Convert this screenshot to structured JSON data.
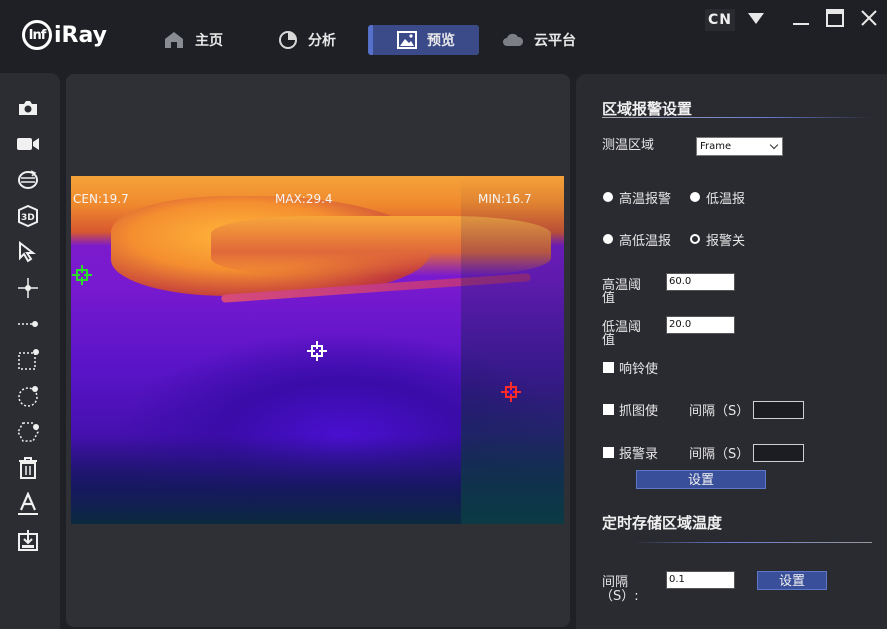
{
  "app": {
    "logo_badge": "Inf",
    "logo_text": "iRay"
  },
  "nav": {
    "home": "主页",
    "analysis": "分析",
    "preview": "预览",
    "cloud": "云平台"
  },
  "lang": {
    "code": "CN"
  },
  "thermal": {
    "cen": "CEN:19.7",
    "max": "MAX:29.4",
    "min": "MIN:16.7"
  },
  "settings": {
    "alarm_title": "区域报警设置",
    "measure_area_label": "测温区域",
    "measure_area_value": "Frame",
    "radio_high": "高温报警",
    "radio_low": "低温报",
    "radio_highlow": "高低温报",
    "radio_off": "报警关",
    "high_threshold_label_1": "高温阈",
    "high_threshold_label_2": "值",
    "high_threshold_value": "60.0",
    "low_threshold_label_1": "低温阈",
    "low_threshold_label_2": "值",
    "low_threshold_value": "20.0",
    "bell_label": "响铃使",
    "capture_label": "抓图使",
    "capture_interval_label": "间隔（S）",
    "record_label": "报警录",
    "record_interval_label": "间隔（S）",
    "set_button": "设置",
    "timed_title": "定时存储区域温度",
    "timed_interval_label_1": "间隔",
    "timed_interval_label_2": "（S）:",
    "timed_interval_value": "0.1",
    "timed_set_button": "设置"
  },
  "colors": {
    "accent": "#3b4b8a",
    "button": "#3a4f9a",
    "panel": "#2a2b31",
    "background": "#1f2025"
  }
}
